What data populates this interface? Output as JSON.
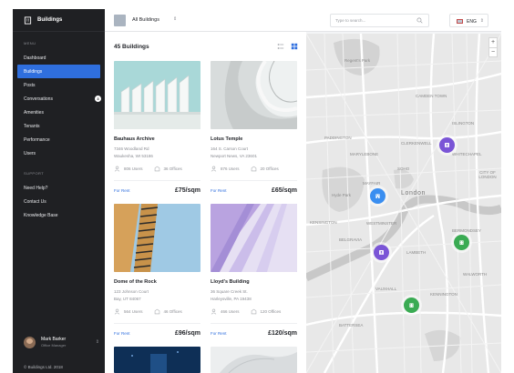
{
  "app": {
    "title": "Buildings"
  },
  "sidebar": {
    "menu_heading": "MENU",
    "items": [
      {
        "label": "Dashboard"
      },
      {
        "label": "Buildings"
      },
      {
        "label": "Posts"
      },
      {
        "label": "Conversations",
        "badge": "3"
      },
      {
        "label": "Amenities"
      },
      {
        "label": "Tenants"
      },
      {
        "label": "Performance"
      },
      {
        "label": "Users"
      }
    ],
    "support_heading": "SUPPORT",
    "support_items": [
      {
        "label": "Need Help?"
      },
      {
        "label": "Contact Us"
      },
      {
        "label": "Knowledge Base"
      }
    ],
    "profile": {
      "name": "Mark Barker",
      "role": "Office Manager"
    },
    "footer": "© Buildings Ltd. 2018"
  },
  "topbar": {
    "selector_label": "All Buildings",
    "search_placeholder": "Type to search...",
    "language": "ENG"
  },
  "listing": {
    "title": "45 Buildings",
    "cards": [
      {
        "name": "Bauhaus Archive",
        "address1": "7346 Woodland Rd",
        "address2": "Waukesha, WI 53186",
        "users": "806 Users",
        "offices": "36 Offices",
        "status": "For Rent",
        "price": "£75/sqm"
      },
      {
        "name": "Lotus Temple",
        "address1": "164 S. Carson Court",
        "address2": "Newport News, VA 23601",
        "users": "876 Users",
        "offices": "20 Offices",
        "status": "For Rent",
        "price": "£65/sqm"
      },
      {
        "name": "Dome of the Rock",
        "address1": "123 Johnson Court",
        "address2": "Bay, UT 84067",
        "users": "564 Users",
        "offices": "46 Offices",
        "status": "For Rent",
        "price": "£96/sqm"
      },
      {
        "name": "Lloyd's Building",
        "address1": "36 Square Creek St.",
        "address2": "Harleysville, PA 19438",
        "users": "466 Users",
        "offices": "120 Offices",
        "status": "For Rent",
        "price": "£120/sqm"
      }
    ]
  },
  "map": {
    "zoom_in": "+",
    "zoom_out": "−",
    "labels": {
      "city": "London",
      "city_of_london": "CITY OF LONDON",
      "westminster": "WESTMINSTER",
      "mayfair": "MAYFAIR",
      "soho": "SOHO",
      "belgravia": "BELGRAVIA",
      "kensington": "KENSINGTON",
      "marylebone": "MARYLEBONE",
      "paddington": "PADDINGTON",
      "regents_park": "Regent's Park",
      "hyde_park": "Hyde Park",
      "lambeth": "LAMBETH",
      "vauxhall": "VAUXHALL",
      "kennington": "KENNINGTON",
      "battersea": "BATTERSEA",
      "walworth": "WALWORTH",
      "bermondsey": "BERMONDSEY",
      "whitechapel": "WHITECHAPEL",
      "clerkenwell": "CLERKENWELL",
      "islington": "ISLINGTON",
      "camden": "CAMDEN TOWN"
    },
    "pin_colors": {
      "purple": "#7a55d6",
      "blue": "#3a8ef0",
      "green": "#3aab53"
    }
  }
}
